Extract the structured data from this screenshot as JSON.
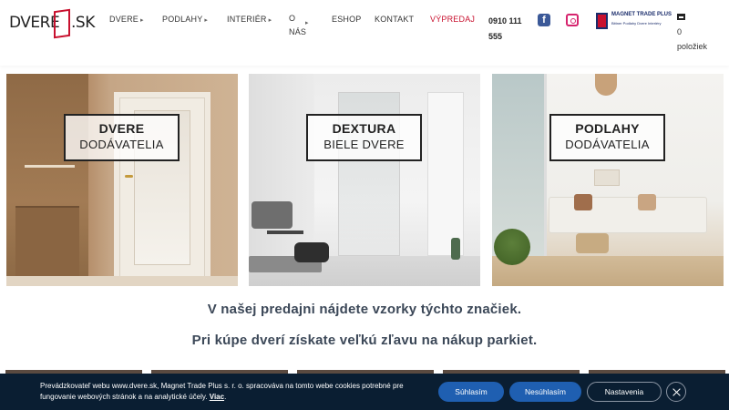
{
  "header": {
    "logo_left": "DVERE",
    "logo_right": "SK",
    "nav": [
      {
        "label": "DVERE",
        "has_submenu": true
      },
      {
        "label": "PODLAHY",
        "has_submenu": true
      },
      {
        "label": "INTERIÉR",
        "has_submenu": true
      },
      {
        "label": "O",
        "has_submenu": false
      },
      {
        "label": "NÁS",
        "has_submenu": false
      },
      {
        "label": "ESHOP",
        "has_submenu": false
      },
      {
        "label": "KONTAKT",
        "has_submenu": false
      },
      {
        "label": "VÝPREDAJ",
        "has_submenu": false
      }
    ],
    "phone": "0910 111 555",
    "facebook_glyph": "f",
    "partner_name": "MAGNET TRADE PLUS",
    "partner_subtitle": "Bittner Podlahy Dvere Interiéry",
    "cart_count_text": "0 položiek",
    "sale_color": "#c8102e",
    "icons": [
      "facebook-icon",
      "instagram-icon",
      "cart-icon",
      "submenu-caret-icon"
    ]
  },
  "tiles": [
    {
      "title": "DVERE",
      "subtitle": "DODÁVATELIA"
    },
    {
      "title": "DEXTURA",
      "subtitle": "BIELE DVERE"
    },
    {
      "title": "PODLAHY",
      "subtitle": "DODÁVATELIA"
    }
  ],
  "promo": {
    "line1": "V našej predajni nájdete vzorky týchto značiek.",
    "line2": "Pri kúpe dverí získate veľkú zľavu na nákup parkiet."
  },
  "cookie": {
    "text": "Prevádzkovateľ webu www.dvere.sk, Magnet Trade Plus s. r. o. spracováva na tomto webe cookies potrebné pre fungovanie webových stránok a na analytické účely.",
    "link_label": "Viac",
    "link_suffix": ".",
    "accept_label": "Súhlasím",
    "reject_label": "Nesúhlasím",
    "settings_label": "Nastavenia",
    "close_icon": "close-icon",
    "bg_color": "#0a1e32",
    "button_color": "#1f5fb1"
  }
}
